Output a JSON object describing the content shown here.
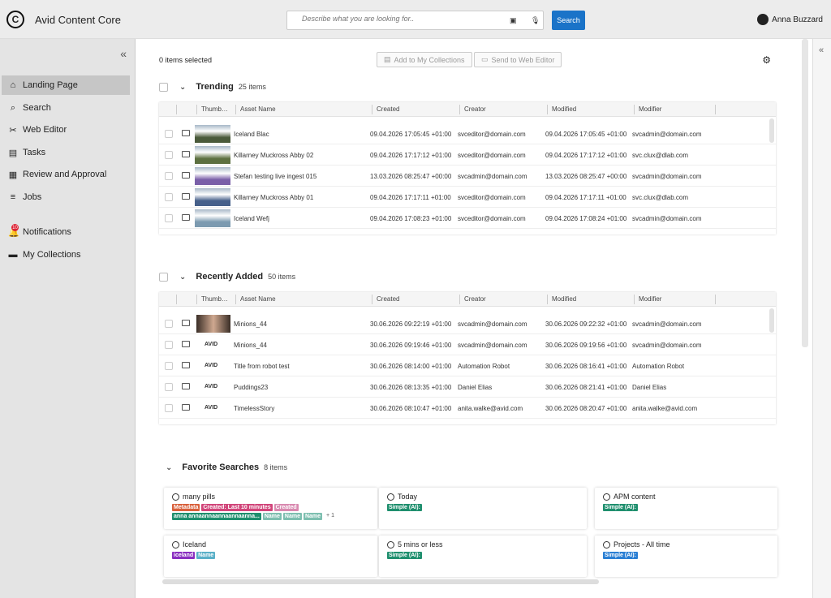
{
  "app": {
    "title": "Avid Content Core",
    "logo": "C",
    "user": "Anna Buzzard"
  },
  "search": {
    "placeholder": "Describe what you are looking for..",
    "button": "Search"
  },
  "sidebar": {
    "collapse": "«",
    "items": [
      {
        "label": "Landing Page",
        "icon": "home-icon",
        "glyph": "⌂"
      },
      {
        "label": "Search",
        "icon": "search-icon",
        "glyph": "⌕"
      },
      {
        "label": "Web Editor",
        "icon": "editor-icon",
        "glyph": "✂"
      },
      {
        "label": "Tasks",
        "icon": "tasks-icon",
        "glyph": "▤"
      },
      {
        "label": "Review and Approval",
        "icon": "review-icon",
        "glyph": "▦"
      },
      {
        "label": "Jobs",
        "icon": "jobs-icon",
        "glyph": "≡"
      },
      {
        "label": "Notifications",
        "icon": "bell-icon",
        "glyph": "🔔",
        "badge": "10"
      },
      {
        "label": "My Collections",
        "icon": "collections-icon",
        "glyph": "▬"
      }
    ]
  },
  "toolbar": {
    "selected": "0 items selected",
    "add_collection": "Add to My Collections",
    "send_editor": "Send to Web Editor"
  },
  "columns": {
    "thumb": "Thumb…",
    "name": "Asset Name",
    "created": "Created",
    "creator": "Creator",
    "modified": "Modified",
    "modifier": "Modifier"
  },
  "trending": {
    "title": "Trending",
    "count": "25 items",
    "rows": [
      {
        "name": "Iceland Blac",
        "created": "09.04.2026 17:05:45 +01:00",
        "creator": "svceditor@domain.com",
        "modified": "09.04.2026 17:05:45 +01:00",
        "modifier": "svcadmin@domain.com",
        "thumb": "#4a5a3a"
      },
      {
        "name": "Killarney Muckross Abby 02",
        "created": "09.04.2026 17:17:12 +01:00",
        "creator": "svceditor@domain.com",
        "modified": "09.04.2026 17:17:12 +01:00",
        "modifier": "svc.clux@dlab.com",
        "thumb": "#5d7040"
      },
      {
        "name": "Stefan testing live ingest 015",
        "created": "13.03.2026 08:25:47 +00:00",
        "creator": "svcadmin@domain.com",
        "modified": "13.03.2026 08:25:47 +00:00",
        "modifier": "svcadmin@domain.com",
        "thumb": "#7a5fa8"
      },
      {
        "name": "Killarney Muckross Abby 01",
        "created": "09.04.2026 17:17:11 +01:00",
        "creator": "svceditor@domain.com",
        "modified": "09.04.2026 17:17:11 +01:00",
        "modifier": "svc.clux@dlab.com",
        "thumb": "#46608a"
      },
      {
        "name": "Iceland Wefj",
        "created": "09.04.2026 17:08:23 +01:00",
        "creator": "svceditor@domain.com",
        "modified": "09.04.2026 17:08:24 +01:00",
        "modifier": "svcadmin@domain.com",
        "thumb": "#7c9ab0"
      }
    ]
  },
  "recent": {
    "title": "Recently Added",
    "count": "50 items",
    "rows": [
      {
        "name": "Minions_44",
        "created": "30.06.2026 09:22:19 +01:00",
        "creator": "svcadmin@domain.com",
        "modified": "30.06.2026 09:22:32 +01:00",
        "modifier": "svcadmin@domain.com",
        "thumb": "photo"
      },
      {
        "name": "Minions_44",
        "created": "30.06.2026 09:19:46 +01:00",
        "creator": "svcadmin@domain.com",
        "modified": "30.06.2026 09:19:56 +01:00",
        "modifier": "svcadmin@domain.com",
        "thumb": "avid"
      },
      {
        "name": "Title from robot test",
        "created": "30.06.2026 08:14:00 +01:00",
        "creator": "Automation Robot",
        "modified": "30.06.2026 08:16:41 +01:00",
        "modifier": "Automation Robot",
        "thumb": "avid"
      },
      {
        "name": "Puddings23",
        "created": "30.06.2026 08:13:35 +01:00",
        "creator": "Daniel Elias",
        "modified": "30.06.2026 08:21:41 +01:00",
        "modifier": "Daniel Elias",
        "thumb": "avid"
      },
      {
        "name": "TimelessStory",
        "created": "30.06.2026 08:10:47 +01:00",
        "creator": "anita.walke@avid.com",
        "modified": "30.06.2026 08:20:47 +01:00",
        "modifier": "anita.walke@avid.com",
        "thumb": "avid"
      }
    ]
  },
  "avid_mark": "AVID",
  "favorites": {
    "title": "Favorite Searches",
    "count": "8 items",
    "cards": [
      {
        "name": "many pills",
        "pills": [
          [
            "Metadata",
            "#d9603b"
          ],
          [
            "Created: Last 10 minutes",
            "#d1457a"
          ],
          [
            "Created",
            "#d98ab0"
          ],
          [
            "anna annaannaannaannaanna...",
            "#1f8f6e"
          ],
          [
            "Name",
            "#7dbfb0"
          ],
          [
            "Name",
            "#7dbfb0"
          ],
          [
            "Name",
            "#7dbfb0"
          ]
        ],
        "more": "+ 1"
      },
      {
        "name": "Today",
        "pills": [
          [
            "Simple (AI):",
            "#1f8f6e"
          ]
        ]
      },
      {
        "name": "APM content",
        "pills": [
          [
            "Simple (AI):",
            "#1f8f6e"
          ]
        ]
      },
      {
        "name": "Iceland",
        "pills": [
          [
            "iceland",
            "#8a2fc0"
          ],
          [
            "Name",
            "#5ab0c8"
          ]
        ]
      },
      {
        "name": "5 mins or less",
        "pills": [
          [
            "Simple (AI):",
            "#1f8f6e"
          ]
        ]
      },
      {
        "name": "Projects - All time",
        "pills": [
          [
            "Simple (AI):",
            "#2a7fd4"
          ]
        ]
      }
    ]
  },
  "right_collapse": "«"
}
